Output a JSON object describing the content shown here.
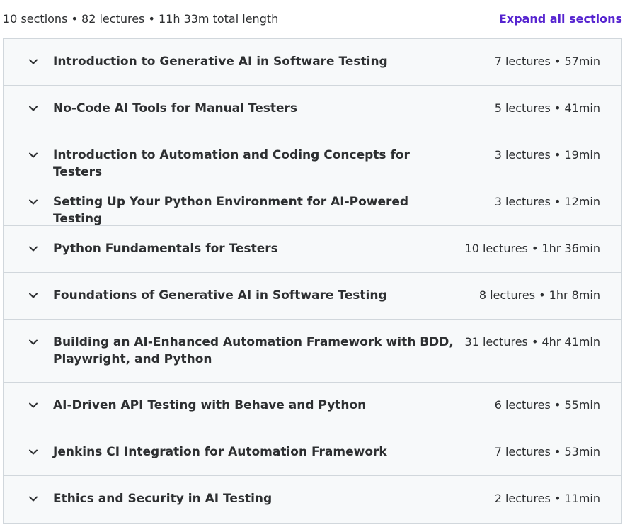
{
  "summary": {
    "text": "10 sections • 82 lectures • 11h 33m total length",
    "expand_label": "Expand all sections"
  },
  "colors": {
    "accent": "#5624d0",
    "section_bg": "#f7f9fa",
    "border": "#d1d7dc",
    "text": "#2d2f31"
  },
  "sections": [
    {
      "title": "Introduction to Generative AI in Software Testing",
      "meta": "7 lectures • 57min",
      "icon": "chevron-down-icon"
    },
    {
      "title": "No-Code AI Tools for Manual Testers",
      "meta": "5 lectures • 41min",
      "icon": "chevron-down-icon"
    },
    {
      "title": "Introduction to Automation and Coding Concepts for Testers",
      "meta": "3 lectures • 19min",
      "icon": "chevron-down-icon"
    },
    {
      "title": "Setting Up Your Python Environment for AI-Powered Testing",
      "meta": "3 lectures • 12min",
      "icon": "chevron-down-icon"
    },
    {
      "title": "Python Fundamentals for Testers",
      "meta": "10 lectures • 1hr 36min",
      "icon": "chevron-down-icon"
    },
    {
      "title": "Foundations of Generative AI in Software Testing",
      "meta": "8 lectures • 1hr 8min",
      "icon": "chevron-down-icon"
    },
    {
      "title": "Building an AI-Enhanced Automation Framework with BDD, Playwright, and Python",
      "meta": "31 lectures • 4hr 41min",
      "icon": "chevron-down-icon"
    },
    {
      "title": "AI-Driven API Testing with Behave and Python",
      "meta": "6 lectures • 55min",
      "icon": "chevron-down-icon"
    },
    {
      "title": "Jenkins CI Integration for Automation Framework",
      "meta": "7 lectures • 53min",
      "icon": "chevron-down-icon"
    },
    {
      "title": "Ethics and Security in AI Testing",
      "meta": "2 lectures • 11min",
      "icon": "chevron-down-icon"
    }
  ]
}
